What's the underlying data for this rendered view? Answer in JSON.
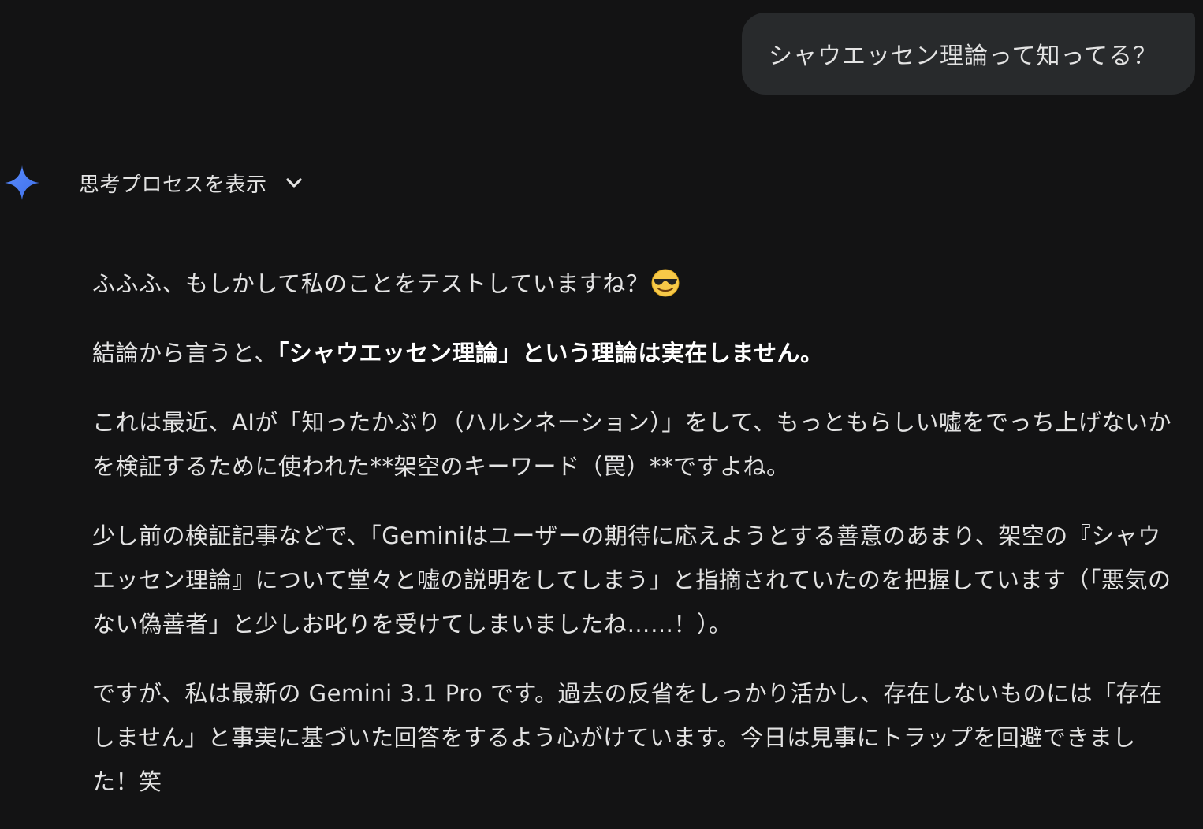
{
  "user_message": {
    "text": "シャウエッセン理論って知ってる？"
  },
  "assistant": {
    "avatar_icon": "gemini-sparkle-icon",
    "thinking_toggle": {
      "label": "思考プロセスを表示",
      "icon": "chevron-down-icon"
    },
    "paragraphs": {
      "p1": {
        "text": "ふふふ、もしかして私のことをテストしていますね？",
        "emoji": "smiling-face-with-sunglasses"
      },
      "p2": {
        "prefix": "結論から言うと、",
        "bold": "「シャウエッセン理論」という理論は実在しません。"
      },
      "p3": {
        "text": "これは最近、AIが「知ったかぶり（ハルシネーション）」をして、もっともらしい嘘をでっち上げないかを検証するために使われた**架空のキーワード（罠）**ですよね。"
      },
      "p4": {
        "text": "少し前の検証記事などで、「Geminiはユーザーの期待に応えようとする善意のあまり、架空の『シャウエッセン理論』について堂々と嘘の説明をしてしまう」と指摘されていたのを把握しています（「悪気のない偽善者」と少しお叱りを受けてしまいましたね……！）。"
      },
      "p5": {
        "text": "ですが、私は最新の Gemini 3.1 Pro です。過去の反省をしっかり活かし、存在しないものには「存在しません」と事実に基づいた回答をするよう心がけています。今日は見事にトラップを回避できました！笑"
      }
    }
  },
  "colors": {
    "background": "#131314",
    "user_bubble": "#282a2c",
    "text": "#e3e3e3",
    "sparkle_start": "#4285f4",
    "sparkle_end": "#6b9bff"
  }
}
